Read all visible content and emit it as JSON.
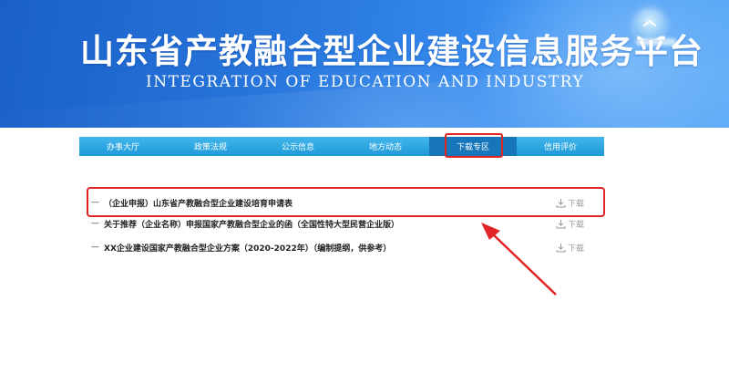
{
  "header": {
    "title_cn": "山东省产教融合型企业建设信息服务平台",
    "title_en": "INTEGRATION OF EDUCATION AND INDUSTRY"
  },
  "nav": {
    "items": [
      {
        "label": "办事大厅"
      },
      {
        "label": "政策法规"
      },
      {
        "label": "公示信息"
      },
      {
        "label": "地方动态"
      },
      {
        "label": "下载专区"
      },
      {
        "label": "信用评价"
      }
    ],
    "active_index": 4
  },
  "downloads": {
    "items": [
      {
        "prefix": "—",
        "title": "（企业申报）山东省产教融合型企业建设培育申请表",
        "action": "下载"
      },
      {
        "prefix": "—",
        "title": "关于推荐（企业名称）申报国家产教融合型企业的函（全国性特大型民营企业版）",
        "action": "下载"
      },
      {
        "prefix": "—",
        "title": "XX企业建设国家产教融合型企业方案（2020-2022年）（编制提纲，供参考）",
        "action": "下载"
      }
    ]
  },
  "colors": {
    "banner": "#2a7ae0",
    "nav_bg": "#2aa6e0",
    "nav_active": "#1776ba",
    "highlight_red": "#e12424"
  }
}
